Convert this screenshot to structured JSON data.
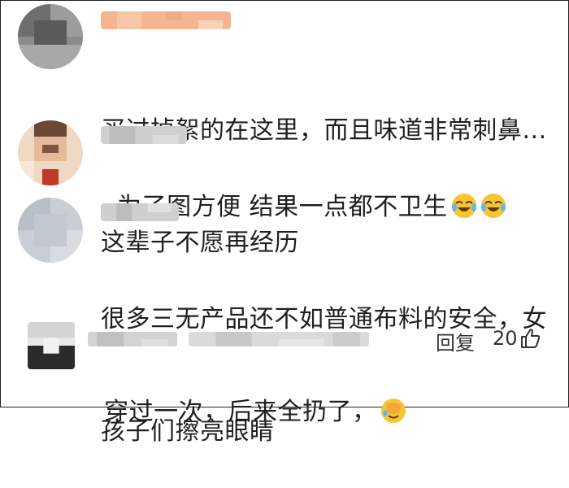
{
  "comments": [
    {
      "text_lines": [
        "买过掉絮的在这里，而且味道非常刺鼻...",
        "这辈子不愿再经历"
      ],
      "user_name": ""
    },
    {
      "text": "为了图方便 结果一点都不卫生",
      "emoji": [
        "laughing-crying-emoji",
        "laughing-crying-emoji"
      ],
      "user_name": ""
    },
    {
      "text_lines": [
        "很多三无产品还不如普通布料的安全，女",
        "孩子们擦亮眼睛"
      ],
      "user_name": ""
    }
  ],
  "reply": {
    "text": "穿过一次，后来全扔了，",
    "emoji": [
      "facepalm-emoji"
    ],
    "reply_label": "回复",
    "like_count": "20",
    "user_name": ""
  },
  "colors": {
    "text": "#1f1f1f",
    "name_blur_orange": "#f3b691",
    "name_blur_gray": "#c9c9c9",
    "border": "#222222"
  }
}
